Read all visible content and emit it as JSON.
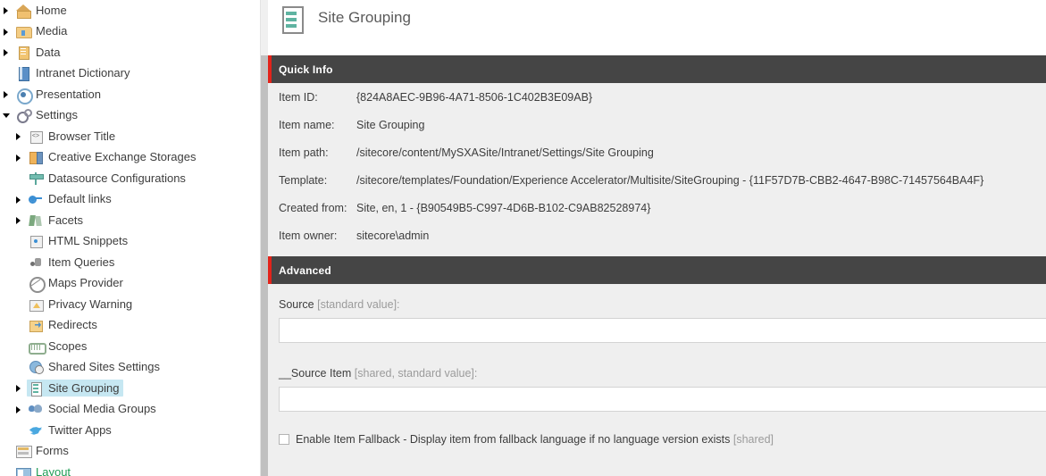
{
  "tree": {
    "items": [
      {
        "label": "Home",
        "icon": "home-icon",
        "indent": 0,
        "twisty": "collapsed",
        "selected": false
      },
      {
        "label": "Media",
        "icon": "media-folder-icon",
        "indent": 0,
        "twisty": "collapsed",
        "selected": false
      },
      {
        "label": "Data",
        "icon": "data-icon",
        "indent": 0,
        "twisty": "collapsed",
        "selected": false
      },
      {
        "label": "Intranet Dictionary",
        "icon": "dictionary-icon",
        "indent": 0,
        "twisty": "none",
        "selected": false
      },
      {
        "label": "Presentation",
        "icon": "presentation-icon",
        "indent": 0,
        "twisty": "collapsed",
        "selected": false
      },
      {
        "label": "Settings",
        "icon": "settings-gear-icon",
        "indent": 0,
        "twisty": "expanded",
        "selected": false
      },
      {
        "label": "Browser Title",
        "icon": "browser-title-icon",
        "indent": 1,
        "twisty": "collapsed",
        "selected": false
      },
      {
        "label": "Creative Exchange Storages",
        "icon": "creative-exchange-icon",
        "indent": 1,
        "twisty": "collapsed",
        "selected": false
      },
      {
        "label": "Datasource Configurations",
        "icon": "datasource-icon",
        "indent": 1,
        "twisty": "none",
        "selected": false
      },
      {
        "label": "Default links",
        "icon": "link-icon",
        "indent": 1,
        "twisty": "collapsed",
        "selected": false
      },
      {
        "label": "Facets",
        "icon": "facets-icon",
        "indent": 1,
        "twisty": "collapsed",
        "selected": false
      },
      {
        "label": "HTML Snippets",
        "icon": "html-snippet-icon",
        "indent": 1,
        "twisty": "none",
        "selected": false
      },
      {
        "label": "Item Queries",
        "icon": "item-query-icon",
        "indent": 1,
        "twisty": "none",
        "selected": false
      },
      {
        "label": "Maps Provider",
        "icon": "maps-provider-icon",
        "indent": 1,
        "twisty": "none",
        "selected": false
      },
      {
        "label": "Privacy Warning",
        "icon": "privacy-warning-icon",
        "indent": 1,
        "twisty": "none",
        "selected": false
      },
      {
        "label": "Redirects",
        "icon": "redirects-icon",
        "indent": 1,
        "twisty": "none",
        "selected": false
      },
      {
        "label": "Scopes",
        "icon": "scopes-icon",
        "indent": 1,
        "twisty": "none",
        "selected": false
      },
      {
        "label": "Shared Sites Settings",
        "icon": "shared-sites-icon",
        "indent": 1,
        "twisty": "none",
        "selected": false
      },
      {
        "label": "Site Grouping",
        "icon": "site-grouping-icon",
        "indent": 1,
        "twisty": "collapsed",
        "selected": true
      },
      {
        "label": "Social Media Groups",
        "icon": "social-media-icon",
        "indent": 1,
        "twisty": "collapsed",
        "selected": false
      },
      {
        "label": "Twitter Apps",
        "icon": "twitter-icon",
        "indent": 1,
        "twisty": "none",
        "selected": false
      },
      {
        "label": "Forms",
        "icon": "forms-icon",
        "indent": -1,
        "twisty": "none",
        "selected": false
      },
      {
        "label": "Layout",
        "icon": "layout-icon",
        "indent": -1,
        "twisty": "none",
        "selected": false,
        "green": true
      }
    ]
  },
  "header": {
    "title": "Site Grouping",
    "icon": "site-grouping-large-icon"
  },
  "quick_info": {
    "section_title": "Quick Info",
    "rows": [
      {
        "label": "Item ID:",
        "value": "{824A8AEC-9B96-4A71-8506-1C402B3E09AB}"
      },
      {
        "label": "Item name:",
        "value": "Site Grouping"
      },
      {
        "label": "Item path:",
        "value": "/sitecore/content/MySXASite/Intranet/Settings/Site Grouping"
      },
      {
        "label": "Template:",
        "value": "/sitecore/templates/Foundation/Experience Accelerator/Multisite/SiteGrouping - {11F57D7B-CBB2-4647-B98C-71457564BA4F}"
      },
      {
        "label": "Created from:",
        "value": "Site, en, 1 - {B90549B5-C997-4D6B-B102-C9AB82528974}"
      },
      {
        "label": "Item owner:",
        "value": "sitecore\\admin"
      }
    ]
  },
  "advanced": {
    "section_title": "Advanced",
    "source_field": {
      "label": "Source",
      "qualifier": "[standard value]:",
      "value": "",
      "placeholder": ""
    },
    "source_item_field": {
      "label": "__Source Item",
      "qualifier": "[shared, standard value]:",
      "value": "",
      "placeholder": ""
    },
    "fallback_checkbox": {
      "label": "Enable Item Fallback - Display item from fallback language if no language version exists",
      "qualifier": "[shared]",
      "checked": false
    }
  },
  "colors": {
    "accent_red": "#e2231a",
    "section_bar": "#454545",
    "selection_blue": "#c6e7f2",
    "panel_bg": "#efefef"
  }
}
